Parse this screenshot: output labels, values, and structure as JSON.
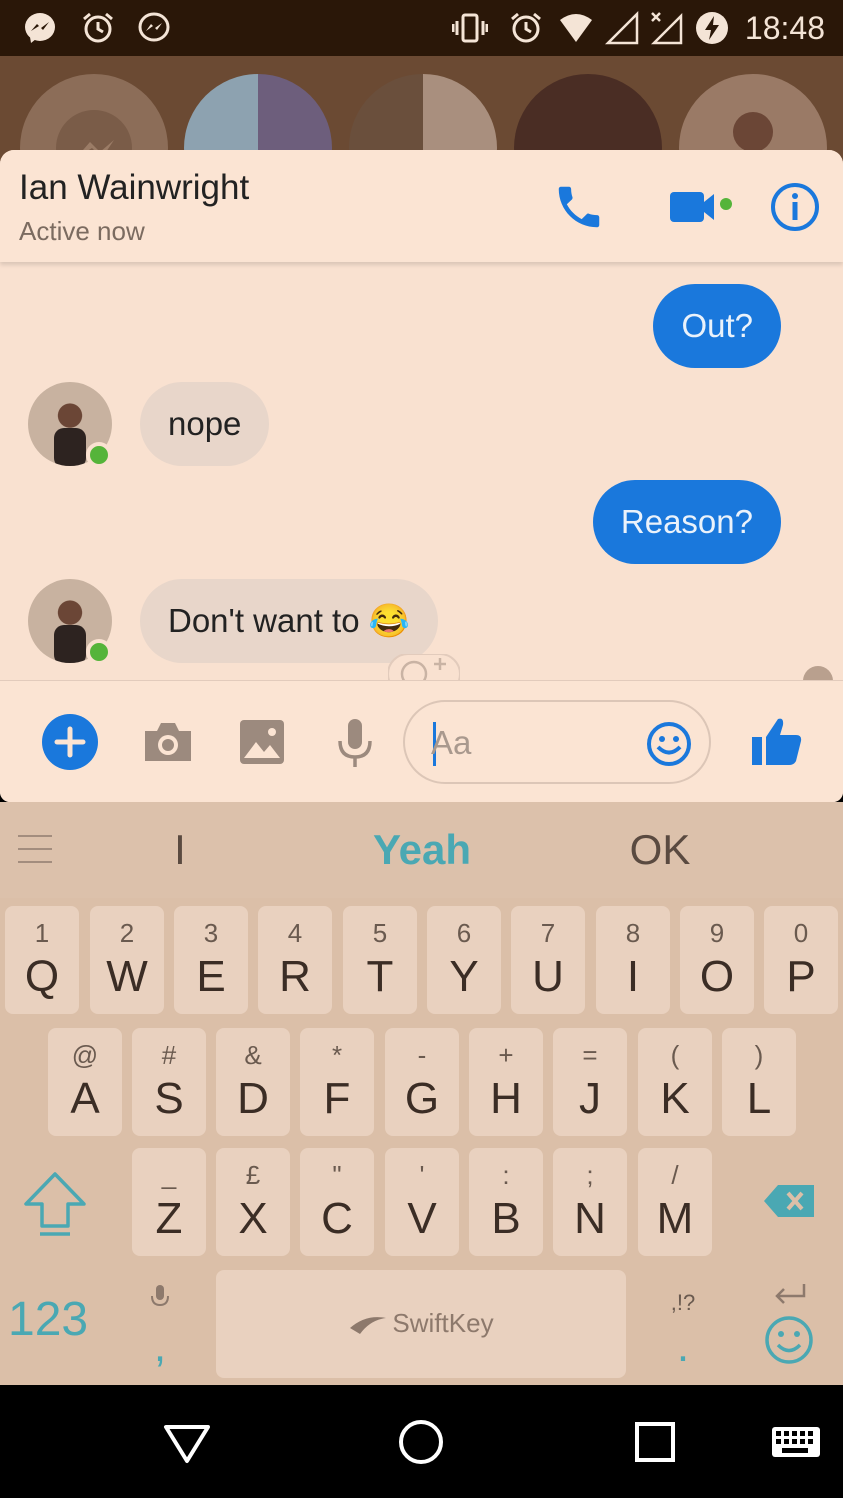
{
  "status_bar": {
    "time": "18:48",
    "icons": [
      "messenger-icon",
      "alarm-icon",
      "messenger-icon",
      "vibrate-icon",
      "alarm-icon",
      "wifi-icon",
      "signal-icon",
      "no-signal-icon",
      "battery-charging-icon"
    ]
  },
  "chat_heads": [
    "messenger-head",
    "group-head-1",
    "group-head-2",
    "contact-head-week",
    "contact-head-ian"
  ],
  "header": {
    "contact_name": "Ian Wainwright",
    "status": "Active now",
    "accent_color": "#1a78dc"
  },
  "messages": [
    {
      "sender": "me",
      "text": "Out?"
    },
    {
      "sender": "contact",
      "text": "nope"
    },
    {
      "sender": "me",
      "text": "Reason?"
    },
    {
      "sender": "contact",
      "text": "Don't want to 😂"
    }
  ],
  "composer": {
    "placeholder": "Aa"
  },
  "keyboard": {
    "suggestions": [
      "I",
      "Yeah",
      "OK"
    ],
    "row1": [
      {
        "main": "Q",
        "sub": "1"
      },
      {
        "main": "W",
        "sub": "2"
      },
      {
        "main": "E",
        "sub": "3"
      },
      {
        "main": "R",
        "sub": "4"
      },
      {
        "main": "T",
        "sub": "5"
      },
      {
        "main": "Y",
        "sub": "6"
      },
      {
        "main": "U",
        "sub": "7"
      },
      {
        "main": "I",
        "sub": "8"
      },
      {
        "main": "O",
        "sub": "9"
      },
      {
        "main": "P",
        "sub": "0"
      }
    ],
    "row2": [
      {
        "main": "A",
        "sub": "@"
      },
      {
        "main": "S",
        "sub": "#"
      },
      {
        "main": "D",
        "sub": "&"
      },
      {
        "main": "F",
        "sub": "*"
      },
      {
        "main": "G",
        "sub": "-"
      },
      {
        "main": "H",
        "sub": "+"
      },
      {
        "main": "J",
        "sub": "="
      },
      {
        "main": "K",
        "sub": "("
      },
      {
        "main": "L",
        "sub": ")"
      }
    ],
    "row3": [
      {
        "main": "Z",
        "sub": "_"
      },
      {
        "main": "X",
        "sub": "£"
      },
      {
        "main": "C",
        "sub": "\""
      },
      {
        "main": "V",
        "sub": "'"
      },
      {
        "main": "B",
        "sub": ":"
      },
      {
        "main": "N",
        "sub": ";"
      },
      {
        "main": "M",
        "sub": "/"
      }
    ],
    "numbers_key": "123",
    "comma_key": ",",
    "period_key": ".",
    "period_sub": ",!?",
    "space_brand": "SwiftKey",
    "accent_color": "#4aa8b3"
  }
}
